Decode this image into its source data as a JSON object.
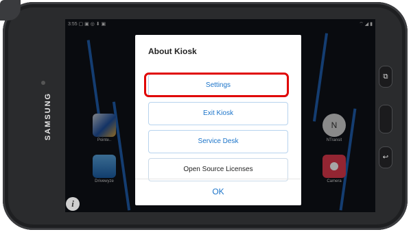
{
  "status_bar": {
    "time": "3:55",
    "left_icons": "▢ ▣ ◎ ⬇ ▣",
    "right_icons": "⌔ ◢ ▮"
  },
  "device": {
    "brand": "SAMSUNG"
  },
  "home_apps": [
    {
      "label": "Pointe..",
      "icon": "pointe-shield-icon"
    },
    {
      "label": "Drivewyze",
      "icon": "drivewyze-icon"
    },
    {
      "label": "NTransit",
      "icon": "ntransit-compass-icon"
    },
    {
      "label": "Camera",
      "icon": "camera-icon"
    }
  ],
  "info_button": {
    "glyph": "i"
  },
  "dialog": {
    "title": "About Kiosk",
    "buttons": [
      "Settings",
      "Exit Kiosk",
      "Service Desk",
      "Open Source Licenses"
    ],
    "ok_label": "OK"
  },
  "hardware_keys": {
    "recent": "⧉",
    "home": "",
    "back": "↩"
  },
  "colors": {
    "accent": "#1a73c9",
    "highlight": "#e00000",
    "wallpaper_line": "#1f5fae"
  }
}
